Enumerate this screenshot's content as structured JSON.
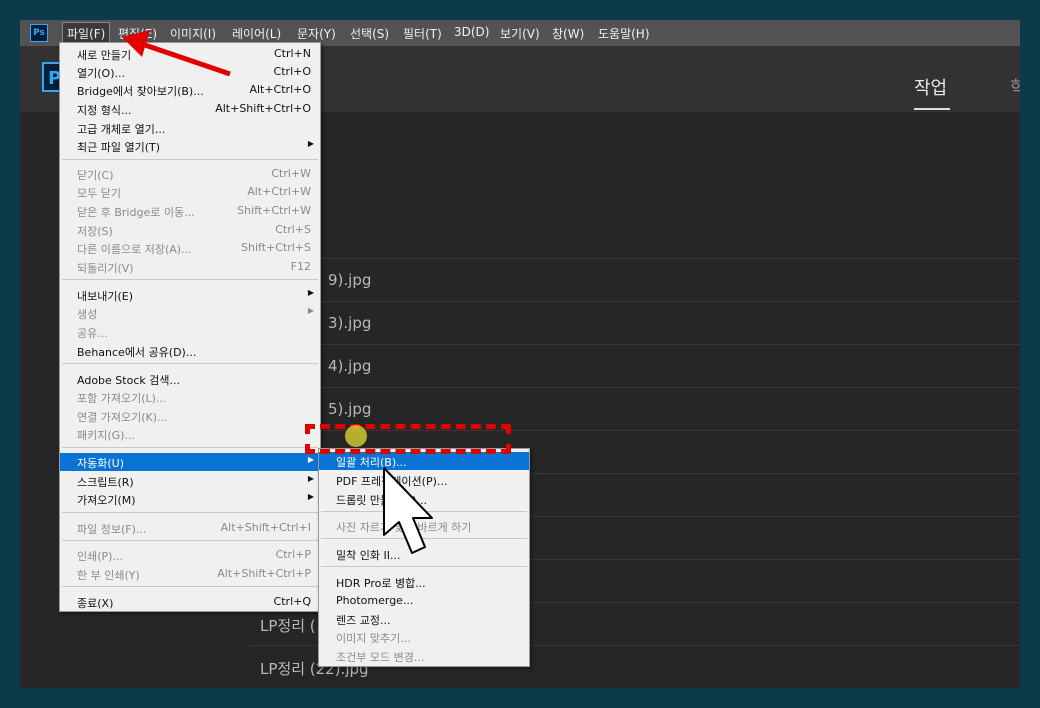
{
  "menubar": {
    "app_icon": "Ps",
    "items": [
      "파일(F)",
      "편집(E)",
      "이미지(I)",
      "레이어(L)",
      "문자(Y)",
      "선택(S)",
      "필터(T)",
      "3D(D)",
      "보기(V)",
      "창(W)",
      "도움말(H)"
    ]
  },
  "header": {
    "logo_letter": "P",
    "tabs": [
      "작업",
      "학"
    ]
  },
  "recent_files": [
    "9).jpg",
    "3).jpg",
    "4).jpg",
    "5).jpg",
    "LP정리 (",
    "LP정리 (22).jpg"
  ],
  "file_menu": [
    {
      "label": "새로 만들기",
      "shortcut": "Ctrl+N"
    },
    {
      "label": "열기(O)...",
      "shortcut": "Ctrl+O"
    },
    {
      "label": "Bridge에서 찾아보기(B)...",
      "shortcut": "Alt+Ctrl+O"
    },
    {
      "label": "지정 형식...",
      "shortcut": "Alt+Shift+Ctrl+O"
    },
    {
      "label": "고급 개체로 열기...",
      "shortcut": ""
    },
    {
      "label": "최근 파일 열기(T)",
      "shortcut": ""
    },
    {
      "label": "닫기(C)",
      "shortcut": "Ctrl+W"
    },
    {
      "label": "모두 닫기",
      "shortcut": "Alt+Ctrl+W"
    },
    {
      "label": "닫은 후 Bridge로 이동...",
      "shortcut": "Shift+Ctrl+W"
    },
    {
      "label": "저장(S)",
      "shortcut": "Ctrl+S"
    },
    {
      "label": "다른 이름으로 저장(A)...",
      "shortcut": "Shift+Ctrl+S"
    },
    {
      "label": "되돌리기(V)",
      "shortcut": "F12"
    },
    {
      "label": "내보내기(E)",
      "shortcut": ""
    },
    {
      "label": "생성",
      "shortcut": ""
    },
    {
      "label": "공유...",
      "shortcut": ""
    },
    {
      "label": "Behance에서 공유(D)...",
      "shortcut": ""
    },
    {
      "label": "Adobe Stock 검색...",
      "shortcut": ""
    },
    {
      "label": "포함 가져오기(L)...",
      "shortcut": ""
    },
    {
      "label": "연결 가져오기(K)...",
      "shortcut": ""
    },
    {
      "label": "패키지(G)...",
      "shortcut": ""
    },
    {
      "label": "자동화(U)",
      "shortcut": ""
    },
    {
      "label": "스크립트(R)",
      "shortcut": ""
    },
    {
      "label": "가져오기(M)",
      "shortcut": ""
    },
    {
      "label": "파일 정보(F)...",
      "shortcut": "Alt+Shift+Ctrl+I"
    },
    {
      "label": "인쇄(P)...",
      "shortcut": "Ctrl+P"
    },
    {
      "label": "한 부 인쇄(Y)",
      "shortcut": "Alt+Shift+Ctrl+P"
    },
    {
      "label": "종료(X)",
      "shortcut": "Ctrl+Q"
    }
  ],
  "automate_menu": [
    {
      "label": "일괄 처리(B)..."
    },
    {
      "label": "PDF 프레젠테이션(P)..."
    },
    {
      "label": "드롭릿 만들기(C)..."
    },
    {
      "label": "사진 자르기 및 똑바르게 하기"
    },
    {
      "label": "밀착 인화 II..."
    },
    {
      "label": "HDR Pro로 병합..."
    },
    {
      "label": "Photomerge..."
    },
    {
      "label": "렌즈 교정..."
    },
    {
      "label": "이미지 맞추기..."
    },
    {
      "label": "조건부 모드 변경..."
    }
  ],
  "colors": {
    "highlight": "#0a74d4",
    "annotation": "#e00000",
    "brand": "#31a8ff"
  },
  "icons": {
    "submenu": "chevron-right-icon",
    "annotation_arrow": "red-arrow-icon",
    "cursor": "cursor-arrow-icon"
  }
}
